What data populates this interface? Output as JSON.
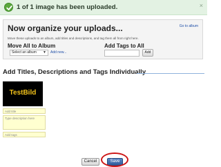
{
  "banner": {
    "message": "1 of 1 image has been uploaded.",
    "close_symbol": "×",
    "color": "#e3f2e3"
  },
  "organize": {
    "title": "Now organize your uploads...",
    "goto_link": "Go to album",
    "subtitle": "Move these uploads to an album, add titles and descriptions, and tag them all from right here.",
    "move_label": "Move All to Album",
    "album_select_value": "Select an album",
    "add_new_link": "Add new...",
    "tags_label": "Add Tags to All",
    "tags_input_value": "",
    "tags_add_button": "Add"
  },
  "individual": {
    "heading": "Add Titles, Descriptions and Tags Individually",
    "thumbnail_text": "TestBild",
    "title_placeholder": "Add title",
    "description_placeholder": "Type description here",
    "tags_placeholder": "Add tags"
  },
  "actions": {
    "cancel_label": "Cancel",
    "save_label": "Save",
    "highlight_color": "#cc1616"
  }
}
